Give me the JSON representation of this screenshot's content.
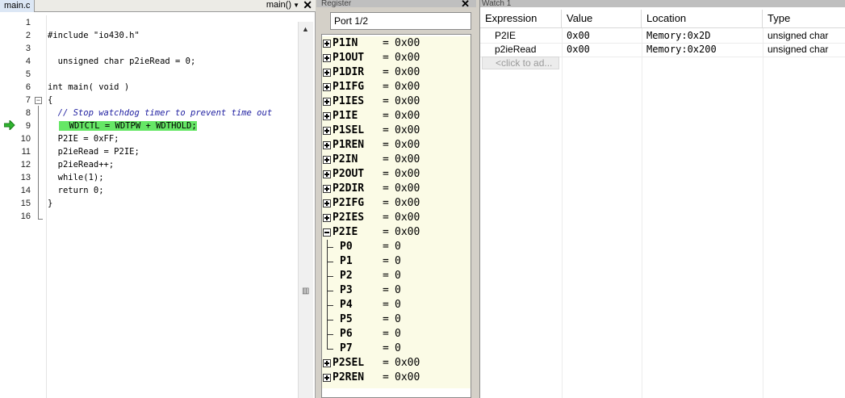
{
  "editor": {
    "tab_label": "main.c",
    "function_label": "main()",
    "close_glyph": "✕",
    "lines": [
      {
        "num": "1",
        "text": ""
      },
      {
        "num": "2",
        "text": "#include \"io430.h\""
      },
      {
        "num": "3",
        "text": ""
      },
      {
        "num": "4",
        "text": "  unsigned char p2ieRead = 0;"
      },
      {
        "num": "5",
        "text": ""
      },
      {
        "num": "6",
        "text": "int main( void )"
      },
      {
        "num": "7",
        "text": "{"
      },
      {
        "num": "8",
        "text": "  // Stop watchdog timer to prevent time out"
      },
      {
        "num": "9",
        "text": "  WDTCTL = WDTPW + WDTHOLD;"
      },
      {
        "num": "10",
        "text": "  P2IE = 0xFF;"
      },
      {
        "num": "11",
        "text": "  p2ieRead = P2IE;"
      },
      {
        "num": "12",
        "text": "  p2ieRead++;"
      },
      {
        "num": "13",
        "text": "  while(1);"
      },
      {
        "num": "14",
        "text": "  return 0;"
      },
      {
        "num": "15",
        "text": "}"
      },
      {
        "num": "16",
        "text": ""
      }
    ],
    "current_line": "9",
    "colors": {
      "highlight": "#66e766",
      "comment": "#1e1ea0",
      "literal": "#008000",
      "pc_arrow": "#2fb52f"
    }
  },
  "register": {
    "title": "Register",
    "close_glyph": "✕",
    "selected_group": "Port 1/2",
    "rows": [
      {
        "name": "P1IN",
        "value": "0x00"
      },
      {
        "name": "P1OUT",
        "value": "0x00"
      },
      {
        "name": "P1DIR",
        "value": "0x00"
      },
      {
        "name": "P1IFG",
        "value": "0x00"
      },
      {
        "name": "P1IES",
        "value": "0x00"
      },
      {
        "name": "P1IE",
        "value": "0x00"
      },
      {
        "name": "P1SEL",
        "value": "0x00"
      },
      {
        "name": "P1REN",
        "value": "0x00"
      },
      {
        "name": "P2IN",
        "value": "0x00"
      },
      {
        "name": "P2OUT",
        "value": "0x00"
      },
      {
        "name": "P2DIR",
        "value": "0x00"
      },
      {
        "name": "P2IFG",
        "value": "0x00"
      },
      {
        "name": "P2IES",
        "value": "0x00"
      }
    ],
    "expanded_row": {
      "name": "P2IE",
      "value": "0x00"
    },
    "bits": [
      {
        "name": "P0",
        "value": "0"
      },
      {
        "name": "P1",
        "value": "0"
      },
      {
        "name": "P2",
        "value": "0"
      },
      {
        "name": "P3",
        "value": "0"
      },
      {
        "name": "P4",
        "value": "0"
      },
      {
        "name": "P5",
        "value": "0"
      },
      {
        "name": "P6",
        "value": "0"
      },
      {
        "name": "P7",
        "value": "0"
      }
    ],
    "rows_after": [
      {
        "name": "P2SEL",
        "value": "0x00"
      },
      {
        "name": "P2REN",
        "value": "0x00"
      }
    ],
    "equals": "="
  },
  "watch": {
    "title": "Watch 1",
    "headers": {
      "expression": "Expression",
      "value": "Value",
      "location": "Location",
      "type": "Type"
    },
    "rows": [
      {
        "expression": "P2IE",
        "value": "0x00",
        "location": "Memory:0x2D",
        "type": "unsigned char"
      },
      {
        "expression": "p2ieRead",
        "value": "0x00",
        "location": "Memory:0x200",
        "type": "unsigned char"
      }
    ],
    "click_to_add": "<click to ad..."
  }
}
